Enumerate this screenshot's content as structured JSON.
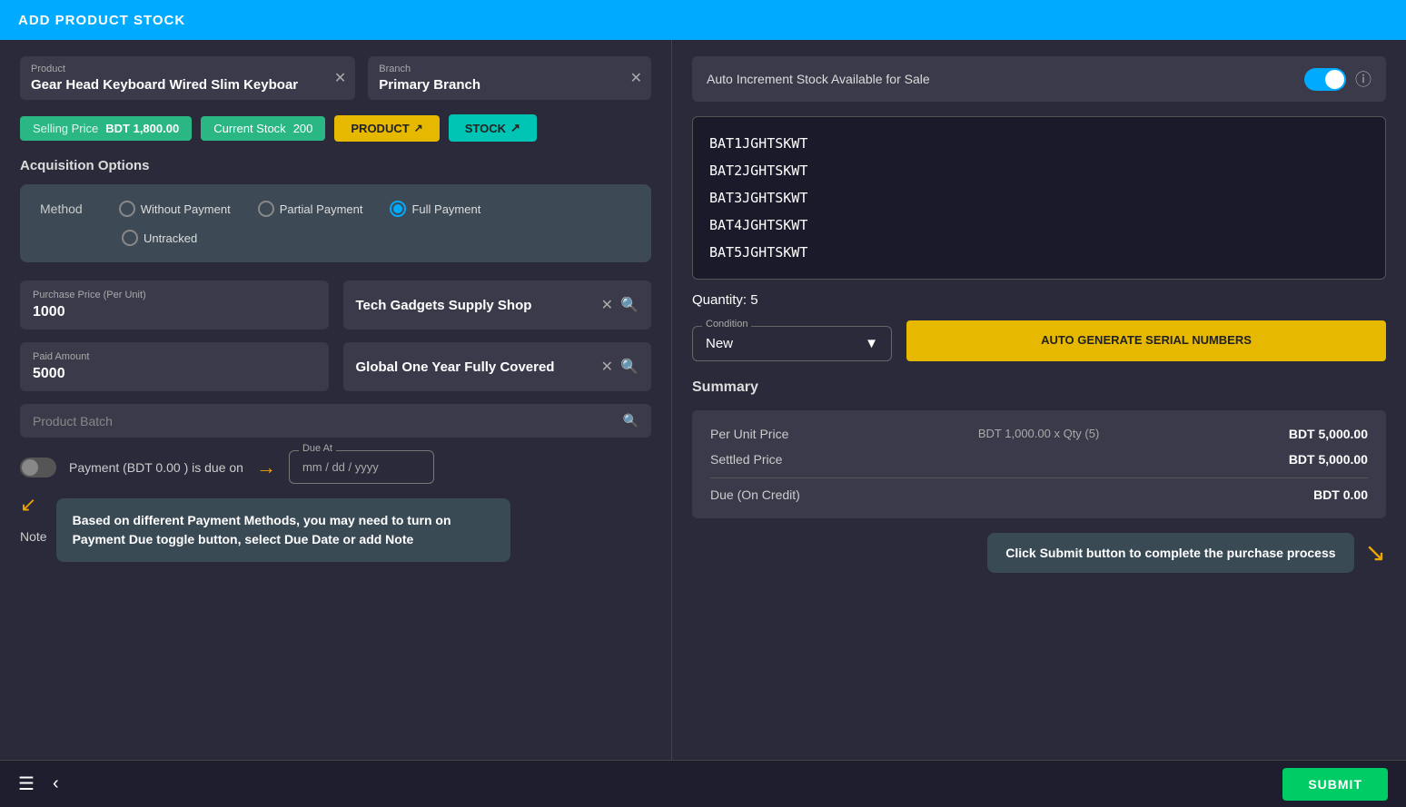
{
  "topBar": {
    "title": "ADD PRODUCT STOCK"
  },
  "leftPanel": {
    "product": {
      "label": "Product",
      "value": "Gear Head Keyboard Wired Slim Keyboar"
    },
    "branch": {
      "label": "Branch",
      "value": "Primary Branch"
    },
    "sellingPrice": {
      "label": "Selling Price",
      "value": "BDT 1,800.00"
    },
    "currentStock": {
      "label": "Current Stock",
      "value": "200"
    },
    "productBtn": "PRODUCT",
    "stockBtn": "STOCK",
    "acquisitionTitle": "Acquisition Options",
    "method": {
      "label": "Method",
      "options": [
        {
          "id": "without-payment",
          "label": "Without Payment",
          "selected": false
        },
        {
          "id": "partial-payment",
          "label": "Partial Payment",
          "selected": false
        },
        {
          "id": "full-payment",
          "label": "Full Payment",
          "selected": true
        },
        {
          "id": "untracked",
          "label": "Untracked",
          "selected": false
        }
      ]
    },
    "purchasePrice": {
      "label": "Purchase Price (Per Unit)",
      "value": "1000"
    },
    "supplier": {
      "value": "Tech Gadgets Supply Shop"
    },
    "paidAmount": {
      "label": "Paid Amount",
      "value": "5000"
    },
    "warranty": {
      "value": "Global One Year Fully Covered"
    },
    "productBatch": {
      "placeholder": "Product Batch"
    },
    "paymentDue": {
      "text": "Payment (BDT 0.00 ) is due on"
    },
    "dueAt": {
      "label": "Due At",
      "placeholder": "mm / dd / yyyy"
    },
    "noteLabel": "Note",
    "tooltip": {
      "text": "Based on different Payment Methods, you may need to turn on Payment Due toggle button, select Due Date or add Note"
    }
  },
  "rightPanel": {
    "autoIncrement": {
      "label": "Auto Increment Stock Available for Sale",
      "enabled": true
    },
    "serialNumbers": [
      "BAT1JGHTSKWT",
      "BAT2JGHTSKWT",
      "BAT3JGHTSKWT",
      "BAT4JGHTSKWT",
      "BAT5JGHTSKWT"
    ],
    "quantity": {
      "label": "Quantity:",
      "value": "5"
    },
    "condition": {
      "label": "Condition",
      "value": "New"
    },
    "autoGenerateBtn": "AUTO GENERATE SERIAL NUMBERS",
    "summaryTitle": "Summary",
    "summary": {
      "perUnitLabel": "Per Unit Price",
      "perUnitCalc": "BDT 1,000.00 x Qty (5)",
      "perUnitValue": "BDT 5,000.00",
      "settledLabel": "Settled Price",
      "settledValue": "BDT 5,000.00",
      "dueLabel": "Due (On Credit)",
      "dueValue": "BDT 0.00"
    },
    "tooltip": {
      "text": "Click Submit button to complete the purchase process"
    }
  },
  "bottomBar": {
    "submitLabel": "SUBMIT"
  }
}
